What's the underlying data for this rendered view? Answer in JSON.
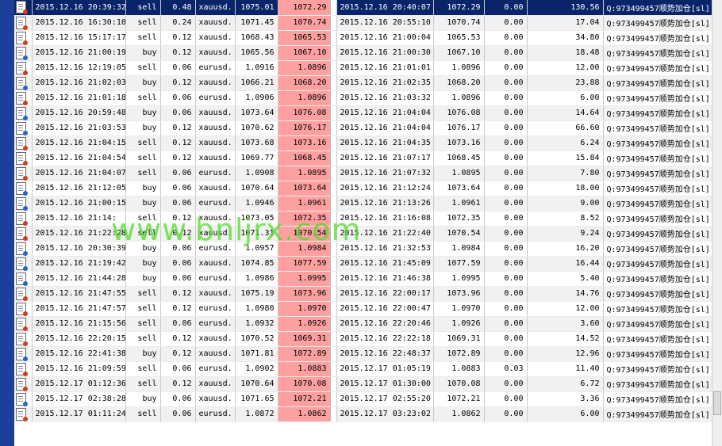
{
  "watermark": "www.bnljrx.com",
  "colors": {
    "selected_row": "#0a246a",
    "close_price_highlight": "#ffa0a0",
    "sell_dot": "#d43c20",
    "buy_dot": "#2266cc",
    "watermark": "#50dc28"
  },
  "rows": [
    {
      "open_time": "2015.12.16 20:39:32",
      "type": "sell",
      "lots": "0.48",
      "symbol": "xauusd.",
      "open_price": "1075.01",
      "close_price": "1072.29",
      "close_time": "2015.12.16 20:40:07",
      "price2": "1072.29",
      "swap": "0.00",
      "profit": "130.56",
      "comment": "Q:973499457顺势加仓[sl]",
      "selected": true
    },
    {
      "open_time": "2015.12.16 16:30:10",
      "type": "sell",
      "lots": "0.24",
      "symbol": "xauusd.",
      "open_price": "1071.45",
      "close_price": "1070.74",
      "close_time": "2015.12.16 20:55:10",
      "price2": "1070.74",
      "swap": "0.00",
      "profit": "17.04",
      "comment": "Q:973499457顺势加仓[sl]"
    },
    {
      "open_time": "2015.12.16 15:17:17",
      "type": "sell",
      "lots": "0.12",
      "symbol": "xauusd.",
      "open_price": "1068.43",
      "close_price": "1065.53",
      "close_time": "2015.12.16 21:00:04",
      "price2": "1065.53",
      "swap": "0.00",
      "profit": "34.80",
      "comment": "Q:973499457顺势加仓[sl]"
    },
    {
      "open_time": "2015.12.16 21:00:19",
      "type": "buy",
      "lots": "0.12",
      "symbol": "xauusd.",
      "open_price": "1065.56",
      "close_price": "1067.10",
      "close_time": "2015.12.16 21:00:30",
      "price2": "1067.10",
      "swap": "0.00",
      "profit": "18.48",
      "comment": "Q:973499457顺势加仓[sl]"
    },
    {
      "open_time": "2015.12.16 12:19:05",
      "type": "sell",
      "lots": "0.06",
      "symbol": "eurusd.",
      "open_price": "1.0916",
      "close_price": "1.0896",
      "close_time": "2015.12.16 21:01:01",
      "price2": "1.0896",
      "swap": "0.00",
      "profit": "12.00",
      "comment": "Q:973499457顺势加仓[sl]"
    },
    {
      "open_time": "2015.12.16 21:02:03",
      "type": "buy",
      "lots": "0.12",
      "symbol": "xauusd.",
      "open_price": "1066.21",
      "close_price": "1068.20",
      "close_time": "2015.12.16 21:02:35",
      "price2": "1068.20",
      "swap": "0.00",
      "profit": "23.88",
      "comment": "Q:973499457顺势加仓[sl]"
    },
    {
      "open_time": "2015.12.16 21:01:18",
      "type": "sell",
      "lots": "0.06",
      "symbol": "eurusd.",
      "open_price": "1.0906",
      "close_price": "1.0896",
      "close_time": "2015.12.16 21:03:32",
      "price2": "1.0896",
      "swap": "0.00",
      "profit": "6.00",
      "comment": "Q:973499457顺势加仓[sl]"
    },
    {
      "open_time": "2015.12.16 20:59:48",
      "type": "buy",
      "lots": "0.06",
      "symbol": "xauusd.",
      "open_price": "1073.64",
      "close_price": "1076.08",
      "close_time": "2015.12.16 21:04:04",
      "price2": "1076.08",
      "swap": "0.00",
      "profit": "14.64",
      "comment": "Q:973499457顺势加仓[sl]"
    },
    {
      "open_time": "2015.12.16 21:03:53",
      "type": "buy",
      "lots": "0.12",
      "symbol": "xauusd.",
      "open_price": "1070.62",
      "close_price": "1076.17",
      "close_time": "2015.12.16 21:04:04",
      "price2": "1076.17",
      "swap": "0.00",
      "profit": "66.60",
      "comment": "Q:973499457顺势加仓[sl]"
    },
    {
      "open_time": "2015.12.16 21:04:15",
      "type": "sell",
      "lots": "0.12",
      "symbol": "xauusd.",
      "open_price": "1073.68",
      "close_price": "1073.16",
      "close_time": "2015.12.16 21:04:35",
      "price2": "1073.16",
      "swap": "0.00",
      "profit": "6.24",
      "comment": "Q:973499457顺势加仓[sl]"
    },
    {
      "open_time": "2015.12.16 21:04:54",
      "type": "sell",
      "lots": "0.12",
      "symbol": "xauusd.",
      "open_price": "1069.77",
      "close_price": "1068.45",
      "close_time": "2015.12.16 21:07:17",
      "price2": "1068.45",
      "swap": "0.00",
      "profit": "15.84",
      "comment": "Q:973499457顺势加仓[sl]"
    },
    {
      "open_time": "2015.12.16 21:04:07",
      "type": "sell",
      "lots": "0.06",
      "symbol": "eurusd.",
      "open_price": "1.0908",
      "close_price": "1.0895",
      "close_time": "2015.12.16 21:07:32",
      "price2": "1.0895",
      "swap": "0.00",
      "profit": "7.80",
      "comment": "Q:973499457顺势加仓[sl]"
    },
    {
      "open_time": "2015.12.16 21:12:05",
      "type": "buy",
      "lots": "0.06",
      "symbol": "xauusd.",
      "open_price": "1070.64",
      "close_price": "1073.64",
      "close_time": "2015.12.16 21:12:24",
      "price2": "1073.64",
      "swap": "0.00",
      "profit": "18.00",
      "comment": "Q:973499457顺势加仓[sl]"
    },
    {
      "open_time": "2015.12.16 21:00:15",
      "type": "buy",
      "lots": "0.06",
      "symbol": "eurusd.",
      "open_price": "1.0946",
      "close_price": "1.0961",
      "close_time": "2015.12.16 21:13:26",
      "price2": "1.0961",
      "swap": "0.00",
      "profit": "9.00",
      "comment": "Q:973499457顺势加仓[sl]"
    },
    {
      "open_time": "2015.12.16 21:14:",
      "type": "sell",
      "lots": "0.12",
      "symbol": "xauusd.",
      "open_price": "1073.05",
      "close_price": "1072.35",
      "close_time": "2015.12.16 21:16:08",
      "price2": "1072.35",
      "swap": "0.00",
      "profit": "8.52",
      "comment": "Q:973499457顺势加仓[sl]"
    },
    {
      "open_time": "2015.12.16 21:22:28",
      "type": "sell",
      "lots": "0.12",
      "symbol": "xauusd.",
      "open_price": "1071.31",
      "close_price": "1070.54",
      "close_time": "2015.12.16 21:22:40",
      "price2": "1070.54",
      "swap": "0.00",
      "profit": "9.24",
      "comment": "Q:973499457顺势加仓[sl]"
    },
    {
      "open_time": "2015.12.16 20:30:39",
      "type": "buy",
      "lots": "0.06",
      "symbol": "eurusd.",
      "open_price": "1.0957",
      "close_price": "1.0984",
      "close_time": "2015.12.16 21:32:53",
      "price2": "1.0984",
      "swap": "0.00",
      "profit": "16.20",
      "comment": "Q:973499457顺势加仓[sl]"
    },
    {
      "open_time": "2015.12.16 21:19:42",
      "type": "buy",
      "lots": "0.06",
      "symbol": "xauusd.",
      "open_price": "1074.85",
      "close_price": "1077.59",
      "close_time": "2015.12.16 21:45:09",
      "price2": "1077.59",
      "swap": "0.00",
      "profit": "16.44",
      "comment": "Q:973499457顺势加仓[sl]"
    },
    {
      "open_time": "2015.12.16 21:44:28",
      "type": "buy",
      "lots": "0.06",
      "symbol": "eurusd.",
      "open_price": "1.0986",
      "close_price": "1.0995",
      "close_time": "2015.12.16 21:46:38",
      "price2": "1.0995",
      "swap": "0.00",
      "profit": "5.40",
      "comment": "Q:973499457顺势加仓[sl]"
    },
    {
      "open_time": "2015.12.16 21:47:55",
      "type": "sell",
      "lots": "0.12",
      "symbol": "xauusd.",
      "open_price": "1075.19",
      "close_price": "1073.96",
      "close_time": "2015.12.16 22:00:17",
      "price2": "1073.96",
      "swap": "0.00",
      "profit": "14.76",
      "comment": "Q:973499457顺势加仓[sl]"
    },
    {
      "open_time": "2015.12.16 21:47:57",
      "type": "sell",
      "lots": "0.12",
      "symbol": "eurusd.",
      "open_price": "1.0980",
      "close_price": "1.0970",
      "close_time": "2015.12.16 22:00:47",
      "price2": "1.0970",
      "swap": "0.00",
      "profit": "12.00",
      "comment": "Q:973499457顺势加仓[sl]"
    },
    {
      "open_time": "2015.12.16 21:15:56",
      "type": "sell",
      "lots": "0.06",
      "symbol": "eurusd.",
      "open_price": "1.0932",
      "close_price": "1.0926",
      "close_time": "2015.12.16 22:20:46",
      "price2": "1.0926",
      "swap": "0.00",
      "profit": "3.60",
      "comment": "Q:973499457顺势加仓[sl]"
    },
    {
      "open_time": "2015.12.16 22:20:15",
      "type": "sell",
      "lots": "0.12",
      "symbol": "xauusd.",
      "open_price": "1070.52",
      "close_price": "1069.31",
      "close_time": "2015.12.16 22:22:18",
      "price2": "1069.31",
      "swap": "0.00",
      "profit": "14.52",
      "comment": "Q:973499457顺势加仓[sl]"
    },
    {
      "open_time": "2015.12.16 22:41:38",
      "type": "buy",
      "lots": "0.12",
      "symbol": "xauusd.",
      "open_price": "1071.81",
      "close_price": "1072.89",
      "close_time": "2015.12.16 22:48:37",
      "price2": "1072.89",
      "swap": "0.00",
      "profit": "12.96",
      "comment": "Q:973499457顺势加仓[sl]"
    },
    {
      "open_time": "2015.12.16 21:09:59",
      "type": "sell",
      "lots": "0.06",
      "symbol": "eurusd.",
      "open_price": "1.0902",
      "close_price": "1.0883",
      "close_time": "2015.12.17 01:05:19",
      "price2": "1.0883",
      "swap": "0.03",
      "profit": "11.40",
      "comment": "Q:973499457顺势加仓[sl]"
    },
    {
      "open_time": "2015.12.17 01:12:36",
      "type": "sell",
      "lots": "0.12",
      "symbol": "xauusd.",
      "open_price": "1070.64",
      "close_price": "1070.08",
      "close_time": "2015.12.17 01:30:00",
      "price2": "1070.08",
      "swap": "0.00",
      "profit": "6.72",
      "comment": "Q:973499457顺势加仓[sl]"
    },
    {
      "open_time": "2015.12.17 02:38:28",
      "type": "buy",
      "lots": "0.06",
      "symbol": "xauusd.",
      "open_price": "1071.65",
      "close_price": "1072.21",
      "close_time": "2015.12.17 02:55:20",
      "price2": "1072.21",
      "swap": "0.00",
      "profit": "3.36",
      "comment": "Q:973499457顺势加仓[sl]"
    },
    {
      "open_time": "2015.12.17 01:11:24",
      "type": "sell",
      "lots": "0.06",
      "symbol": "eurusd.",
      "open_price": "1.0872",
      "close_price": "1.0862",
      "close_time": "2015.12.17 03:23:02",
      "price2": "1.0862",
      "swap": "0.00",
      "profit": "6.00",
      "comment": "Q:973499457顺势加仓[sl]"
    }
  ]
}
